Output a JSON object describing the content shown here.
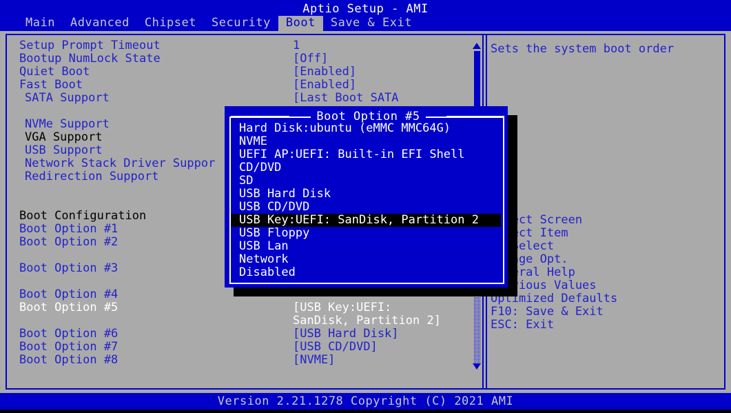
{
  "window": {
    "title": "Aptio Setup - AMI",
    "footer": "Version 2.21.1278 Copyright (C) 2021 AMI"
  },
  "menubar": {
    "items": [
      {
        "label": "Main",
        "active": false
      },
      {
        "label": "Advanced",
        "active": false
      },
      {
        "label": "Chipset",
        "active": false
      },
      {
        "label": "Security",
        "active": false
      },
      {
        "label": "Boot",
        "active": true
      },
      {
        "label": "Save & Exit",
        "active": false
      }
    ]
  },
  "settings": {
    "rows": [
      {
        "label": "Setup Prompt Timeout",
        "value": "1",
        "style": "normal",
        "indent": false
      },
      {
        "label": "Bootup NumLock State",
        "value": "[Off]",
        "style": "normal",
        "indent": false
      },
      {
        "label": "Quiet Boot",
        "value": "[Enabled]",
        "style": "normal",
        "indent": false
      },
      {
        "label": "Fast Boot",
        "value": "[Enabled]",
        "style": "normal",
        "indent": false
      },
      {
        "label": "SATA Support",
        "value": "[Last Boot SATA",
        "style": "normal",
        "indent": true
      },
      {
        "label": "",
        "value": "",
        "style": "normal",
        "indent": false
      },
      {
        "label": "NVMe Support",
        "value": "",
        "style": "normal",
        "indent": true
      },
      {
        "label": "VGA Support",
        "value": "",
        "style": "dim",
        "indent": true
      },
      {
        "label": "USB Support",
        "value": "",
        "style": "normal",
        "indent": true
      },
      {
        "label": "Network Stack Driver Suppor",
        "value": "",
        "style": "normal",
        "indent": true
      },
      {
        "label": "Redirection Support",
        "value": "",
        "style": "normal",
        "indent": true
      },
      {
        "label": "",
        "value": "",
        "style": "normal",
        "indent": false
      },
      {
        "label": "",
        "value": "",
        "style": "normal",
        "indent": false
      },
      {
        "label": "Boot Configuration",
        "value": "",
        "style": "header",
        "indent": false
      },
      {
        "label": "Boot Option #1",
        "value": "",
        "style": "normal",
        "indent": false
      },
      {
        "label": "Boot Option #2",
        "value": "",
        "style": "normal",
        "indent": false
      },
      {
        "label": "",
        "value": "",
        "style": "normal",
        "indent": false
      },
      {
        "label": "Boot Option #3",
        "value": "",
        "style": "normal",
        "indent": false
      },
      {
        "label": "",
        "value": "",
        "style": "normal",
        "indent": false
      },
      {
        "label": "Boot Option #4",
        "value": "",
        "style": "normal",
        "indent": false
      },
      {
        "label": "Boot Option #5",
        "value": "[USB Key:UEFI:",
        "style": "selected",
        "indent": false
      },
      {
        "label": "",
        "value": "SanDisk, Partition 2]",
        "style": "selected",
        "indent": false
      },
      {
        "label": "Boot Option #6",
        "value": "[USB Hard Disk]",
        "style": "normal",
        "indent": false
      },
      {
        "label": "Boot Option #7",
        "value": "[USB CD/DVD]",
        "style": "normal",
        "indent": false
      },
      {
        "label": "Boot Option #8",
        "value": "[NVME]",
        "style": "normal",
        "indent": false
      }
    ]
  },
  "scrollbar": {
    "up_arrow": "scroll-up-arrow",
    "down_arrow": "scroll-down-arrow"
  },
  "help": {
    "text": "Sets the system boot order",
    "keys": [
      {
        "label": "Select Screen"
      },
      {
        "label": "Select Item"
      },
      {
        "label": "r: Select"
      },
      {
        "label": " Change Opt."
      },
      {
        "label": "General Help"
      },
      {
        "label": "Previous Values"
      },
      {
        "label": "Optimized Defaults"
      },
      {
        "label": "F10: Save & Exit"
      },
      {
        "label": "ESC: Exit"
      }
    ]
  },
  "popup": {
    "title": "Boot Option #5",
    "options": [
      {
        "label": "Hard Disk:ubuntu (eMMC MMC64G)",
        "selected": false
      },
      {
        "label": "NVME",
        "selected": false
      },
      {
        "label": "UEFI AP:UEFI: Built-in EFI Shell",
        "selected": false
      },
      {
        "label": "CD/DVD",
        "selected": false
      },
      {
        "label": "SD",
        "selected": false
      },
      {
        "label": "USB Hard Disk",
        "selected": false
      },
      {
        "label": "USB CD/DVD",
        "selected": false
      },
      {
        "label": "USB Key:UEFI: SanDisk, Partition 2",
        "selected": true
      },
      {
        "label": "USB Floppy",
        "selected": false
      },
      {
        "label": "USB Lan",
        "selected": false
      },
      {
        "label": "Network",
        "selected": false
      },
      {
        "label": "Disabled",
        "selected": false
      }
    ]
  },
  "colors": {
    "background": "#aaaaaa",
    "blue": "#0000c8",
    "text_blue": "#2222cc",
    "white": "#ffffff",
    "black": "#000000"
  }
}
